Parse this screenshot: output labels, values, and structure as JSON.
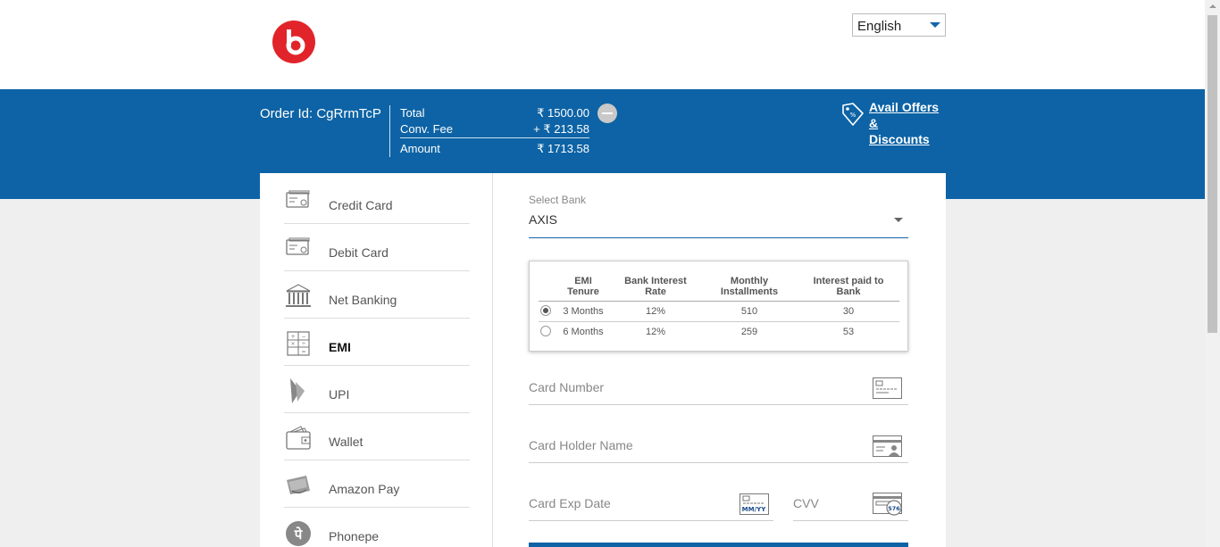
{
  "header": {
    "logo_letter": "b",
    "brand_color": "#e1242a",
    "language": {
      "selected": "English"
    }
  },
  "summary": {
    "order_id": "Order Id: CgRrmTcP",
    "rows": [
      {
        "label": "Total",
        "value": "₹ 1500.00"
      },
      {
        "label": "Conv. Fee",
        "value": "+ ₹ 213.58"
      },
      {
        "label": "Amount",
        "value": "₹ 1713.58"
      }
    ],
    "offers_link_line1": "Avail Offers &",
    "offers_link_line2": "Discounts",
    "band_color": "#0d63a5"
  },
  "sidebar": {
    "items": [
      {
        "label": "Credit Card",
        "icon": "credit-card-icon",
        "active": false
      },
      {
        "label": "Debit Card",
        "icon": "debit-card-icon",
        "active": false
      },
      {
        "label": "Net Banking",
        "icon": "bank-icon",
        "active": false
      },
      {
        "label": "EMI",
        "icon": "calculator-icon",
        "active": true
      },
      {
        "label": "UPI",
        "icon": "upi-icon",
        "active": false
      },
      {
        "label": "Wallet",
        "icon": "wallet-icon",
        "active": false
      },
      {
        "label": "Amazon Pay",
        "icon": "amazon-pay-icon",
        "active": false
      },
      {
        "label": "Phonepe",
        "icon": "phonepe-icon",
        "active": false
      }
    ]
  },
  "emi": {
    "select_caption": "Select Bank",
    "selected_bank": "AXIS",
    "table": {
      "headers": [
        [
          "EMI",
          "Tenure"
        ],
        [
          "Bank Interest",
          "Rate"
        ],
        [
          "Monthly",
          "Installments"
        ],
        [
          "Interest paid to",
          "Bank"
        ]
      ],
      "rows": [
        {
          "selected": true,
          "cells": [
            "3 Months",
            "12%",
            "510",
            "30"
          ]
        },
        {
          "selected": false,
          "cells": [
            "6 Months",
            "12%",
            "259",
            "53"
          ]
        }
      ]
    }
  },
  "form": {
    "card_number_placeholder": "Card Number",
    "card_holder_placeholder": "Card Holder Name",
    "card_exp_placeholder": "Card Exp Date",
    "cvv_placeholder": "CVV",
    "exp_icon_text": "MM/YY",
    "cvv_icon_text": "576"
  }
}
